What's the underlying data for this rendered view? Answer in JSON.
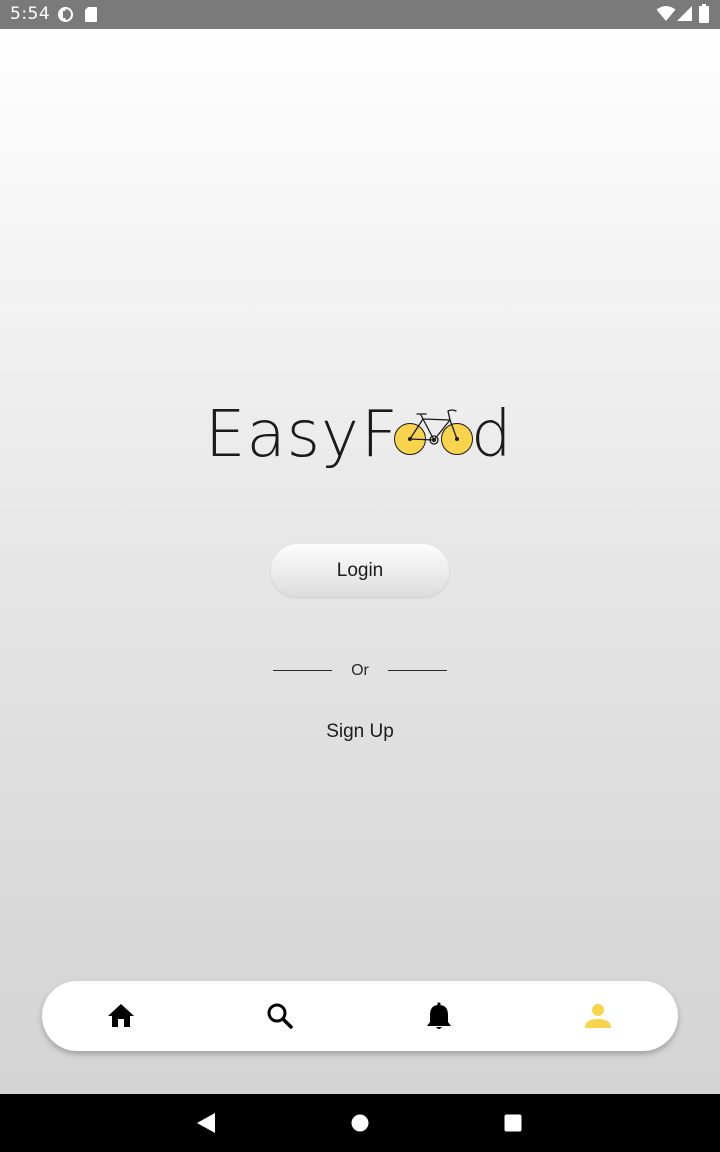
{
  "status_bar": {
    "time": "5:54",
    "icons_left": [
      "data-saver-icon",
      "sd-card-icon"
    ],
    "icons_right": [
      "wifi-icon",
      "cell-signal-icon",
      "battery-icon"
    ]
  },
  "logo": {
    "text_easy": "Easy",
    "text_f": "F",
    "text_d": "d",
    "accent_color": "#f7d44c"
  },
  "auth": {
    "login_label": "Login",
    "divider_text": "Or",
    "signup_label": "Sign Up"
  },
  "tab_bar": {
    "tabs": [
      {
        "icon": "home-icon",
        "active": false
      },
      {
        "icon": "search-icon",
        "active": false
      },
      {
        "icon": "bell-icon",
        "active": false
      },
      {
        "icon": "person-icon",
        "active": true
      }
    ],
    "active_color": "#f7d44c",
    "inactive_color": "#000000"
  },
  "nav_bar": {
    "buttons": [
      "back-icon",
      "home-circle-icon",
      "recents-icon"
    ]
  }
}
